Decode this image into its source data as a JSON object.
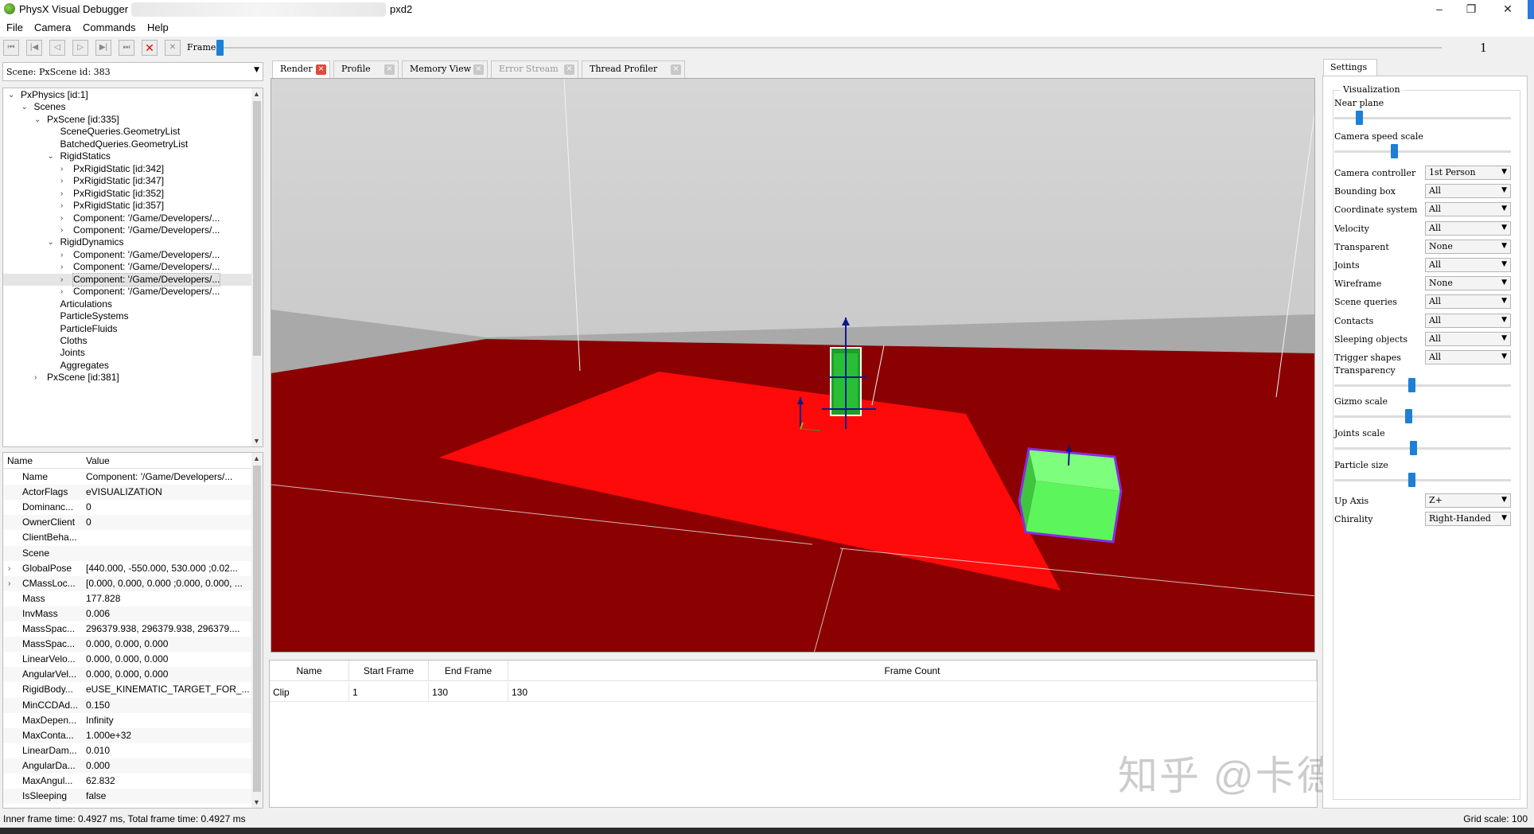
{
  "window": {
    "app_name": "PhysX Visual Debugger",
    "title_suffix": "pxd2",
    "minimize": "–",
    "maximize": "❐",
    "close": "✕"
  },
  "menu": [
    "File",
    "Camera",
    "Commands",
    "Help"
  ],
  "toolbar": {
    "frame_label": "Frame",
    "frame_number": "1",
    "frame_progress": 0.0
  },
  "scene_selector": {
    "label": "Scene: PxScene id: 383"
  },
  "tree": [
    {
      "label": "PxPhysics [id:1]",
      "depth": 0,
      "chev": "v"
    },
    {
      "label": "Scenes",
      "depth": 1,
      "chev": "v"
    },
    {
      "label": "PxScene [id:335]",
      "depth": 2,
      "chev": "v"
    },
    {
      "label": "SceneQueries.GeometryList",
      "depth": 3,
      "chev": ""
    },
    {
      "label": "BatchedQueries.GeometryList",
      "depth": 3,
      "chev": ""
    },
    {
      "label": "RigidStatics",
      "depth": 3,
      "chev": "v"
    },
    {
      "label": "PxRigidStatic [id:342]",
      "depth": 4,
      "chev": ">"
    },
    {
      "label": "PxRigidStatic [id:347]",
      "depth": 4,
      "chev": ">"
    },
    {
      "label": "PxRigidStatic [id:352]",
      "depth": 4,
      "chev": ">"
    },
    {
      "label": "PxRigidStatic [id:357]",
      "depth": 4,
      "chev": ">"
    },
    {
      "label": "Component: '/Game/Developers/...",
      "depth": 4,
      "chev": ">"
    },
    {
      "label": "Component: '/Game/Developers/...",
      "depth": 4,
      "chev": ">"
    },
    {
      "label": "RigidDynamics",
      "depth": 3,
      "chev": "v"
    },
    {
      "label": "Component: '/Game/Developers/...",
      "depth": 4,
      "chev": ">"
    },
    {
      "label": "Component: '/Game/Developers/...",
      "depth": 4,
      "chev": ">"
    },
    {
      "label": "Component: '/Game/Developers/...",
      "depth": 4,
      "chev": ">",
      "selected": true
    },
    {
      "label": "Component: '/Game/Developers/...",
      "depth": 4,
      "chev": ">"
    },
    {
      "label": "Articulations",
      "depth": 3,
      "chev": ""
    },
    {
      "label": "ParticleSystems",
      "depth": 3,
      "chev": ""
    },
    {
      "label": "ParticleFluids",
      "depth": 3,
      "chev": ""
    },
    {
      "label": "Cloths",
      "depth": 3,
      "chev": ""
    },
    {
      "label": "Joints",
      "depth": 3,
      "chev": ""
    },
    {
      "label": "Aggregates",
      "depth": 3,
      "chev": ""
    },
    {
      "label": "PxScene [id:381]",
      "depth": 2,
      "chev": ">"
    }
  ],
  "properties": {
    "header_name": "Name",
    "header_value": "Value",
    "rows": [
      {
        "name": "Name",
        "value": "Component: '/Game/Developers/...",
        "exp": false
      },
      {
        "name": "ActorFlags",
        "value": "eVISUALIZATION",
        "exp": false
      },
      {
        "name": "Dominanc...",
        "value": "0",
        "exp": false
      },
      {
        "name": "OwnerClient",
        "value": "0",
        "exp": false
      },
      {
        "name": "ClientBeha...",
        "value": "",
        "exp": false
      },
      {
        "name": "Scene",
        "value": "",
        "exp": false
      },
      {
        "name": "GlobalPose",
        "value": "[440.000, -550.000, 530.000 ;0.02...",
        "exp": true
      },
      {
        "name": "CMassLoc...",
        "value": "[0.000, 0.000, 0.000 ;0.000, 0.000, ...",
        "exp": true
      },
      {
        "name": "Mass",
        "value": "177.828",
        "exp": false
      },
      {
        "name": "InvMass",
        "value": "0.006",
        "exp": false
      },
      {
        "name": "MassSpac...",
        "value": "296379.938, 296379.938, 296379....",
        "exp": false
      },
      {
        "name": "MassSpac...",
        "value": "0.000, 0.000, 0.000",
        "exp": false
      },
      {
        "name": "LinearVelo...",
        "value": "0.000, 0.000, 0.000",
        "exp": false
      },
      {
        "name": "AngularVel...",
        "value": "0.000, 0.000, 0.000",
        "exp": false
      },
      {
        "name": "RigidBody...",
        "value": "eUSE_KINEMATIC_TARGET_FOR_...",
        "exp": false
      },
      {
        "name": "MinCCDAd...",
        "value": "0.150",
        "exp": false
      },
      {
        "name": "MaxDepen...",
        "value": "Infinity",
        "exp": false
      },
      {
        "name": "MaxConta...",
        "value": "1.000e+32",
        "exp": false
      },
      {
        "name": "LinearDam...",
        "value": "0.010",
        "exp": false
      },
      {
        "name": "AngularDa...",
        "value": "0.000",
        "exp": false
      },
      {
        "name": "MaxAngul...",
        "value": "62.832",
        "exp": false
      },
      {
        "name": "IsSleeping",
        "value": "false",
        "exp": false
      }
    ]
  },
  "tabs": [
    {
      "label": "Render",
      "active": true,
      "disabled": false
    },
    {
      "label": "Profile",
      "active": false,
      "disabled": false
    },
    {
      "label": "Memory View",
      "active": false,
      "disabled": false
    },
    {
      "label": "Error Stream",
      "active": false,
      "disabled": true
    },
    {
      "label": "Thread Profiler",
      "active": false,
      "disabled": false
    }
  ],
  "clips": {
    "headers": [
      "Name",
      "Start Frame",
      "End Frame",
      "Frame Count"
    ],
    "rows": [
      [
        "Clip",
        "1",
        "130",
        "130"
      ]
    ]
  },
  "watermark": "知乎 @卡德卡斯基",
  "settings": {
    "tab_label": "Settings",
    "group_title": "Visualization",
    "sliders": [
      {
        "label": "Near plane",
        "level": 0.12
      },
      {
        "label": "Camera speed scale",
        "level": 0.32
      }
    ],
    "combos_a": [
      {
        "label": "Camera controller",
        "value": "1st Person"
      },
      {
        "label": "Bounding box",
        "value": "All"
      },
      {
        "label": "Coordinate system",
        "value": "All"
      },
      {
        "label": "Velocity",
        "value": "All"
      },
      {
        "label": "Transparent",
        "value": "None"
      },
      {
        "label": "Joints",
        "value": "All"
      },
      {
        "label": "Wireframe",
        "value": "None"
      },
      {
        "label": "Scene queries",
        "value": "All"
      },
      {
        "label": "Contacts",
        "value": "All"
      },
      {
        "label": "Sleeping objects",
        "value": "All"
      },
      {
        "label": "Trigger shapes",
        "value": "All"
      }
    ],
    "sliders_b": [
      {
        "label": "Transparency",
        "level": 0.42
      },
      {
        "label": "Gizmo scale",
        "level": 0.4
      },
      {
        "label": "Joints scale",
        "level": 0.43
      },
      {
        "label": "Particle size",
        "level": 0.42
      }
    ],
    "combos_b": [
      {
        "label": "Up Axis",
        "value": "Z+"
      },
      {
        "label": "Chirality",
        "value": "Right-Handed"
      }
    ]
  },
  "status": {
    "left": "Inner frame time: 0.4927 ms, Total frame time: 0.4927 ms",
    "right": "Grid scale: 100"
  },
  "colors": {
    "accent": "#1e7fd6",
    "floor": "#8b0000",
    "plane": "#ff0a0a",
    "wall": "#c0c0c0",
    "cube": "#5cf55c"
  }
}
